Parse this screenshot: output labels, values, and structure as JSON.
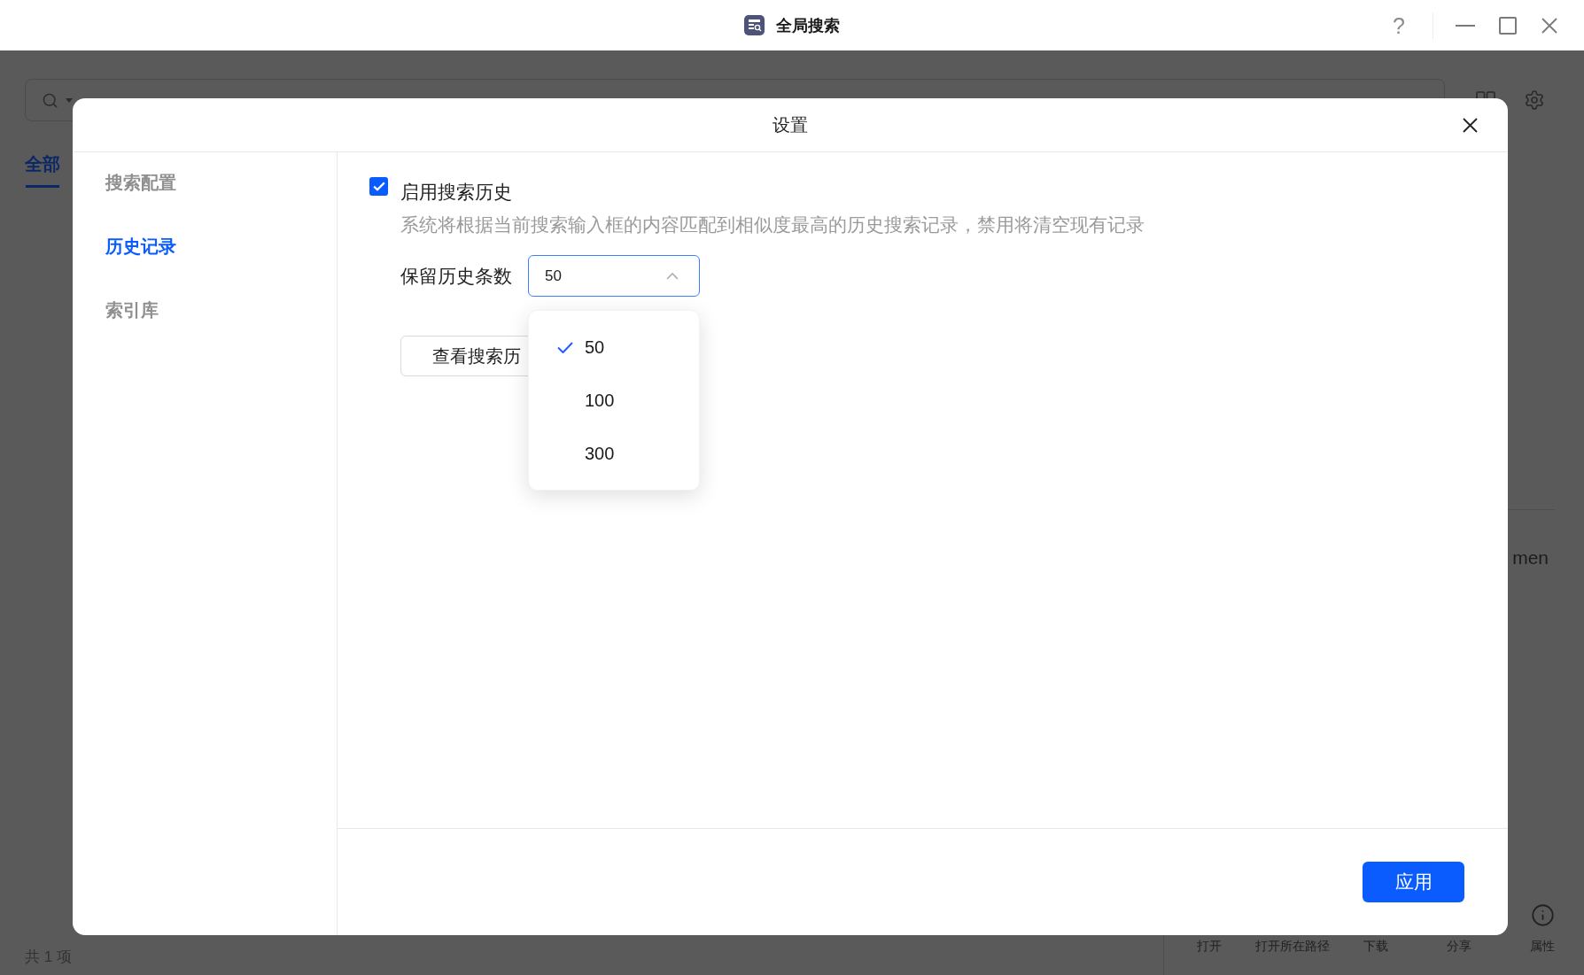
{
  "window": {
    "title": "全局搜索",
    "help": "?"
  },
  "tabs": [
    {
      "label": "全部",
      "selected": true
    }
  ],
  "results": {
    "name_fragment": "men"
  },
  "status_bar": {
    "count": "共 1 项"
  },
  "toolbar": [
    {
      "label": "打开",
      "kind": "plain"
    },
    {
      "label": "打开所在路径",
      "kind": "plain"
    },
    {
      "label": "下载",
      "kind": "plain"
    },
    {
      "label": "分享",
      "kind": "plain"
    },
    {
      "label": "属性",
      "kind": "info"
    }
  ],
  "dialog": {
    "title": "设置",
    "nav": [
      {
        "label": "搜索配置",
        "selected": false
      },
      {
        "label": "历史记录",
        "selected": true
      },
      {
        "label": "索引库",
        "selected": false
      }
    ],
    "history": {
      "enable": {
        "label": "启用搜索历史",
        "checked": true
      },
      "description": "系统将根据当前搜索输入框的内容匹配到相似度最高的历史搜索记录，禁用将清空现有记录",
      "keep_count": {
        "label": "保留历史条数",
        "value": "50",
        "expanded": true,
        "options": [
          {
            "label": "50",
            "selected": true
          },
          {
            "label": "100",
            "selected": false
          },
          {
            "label": "300",
            "selected": false
          }
        ]
      },
      "view_button": "查看搜索历"
    },
    "apply_button": "应用"
  }
}
